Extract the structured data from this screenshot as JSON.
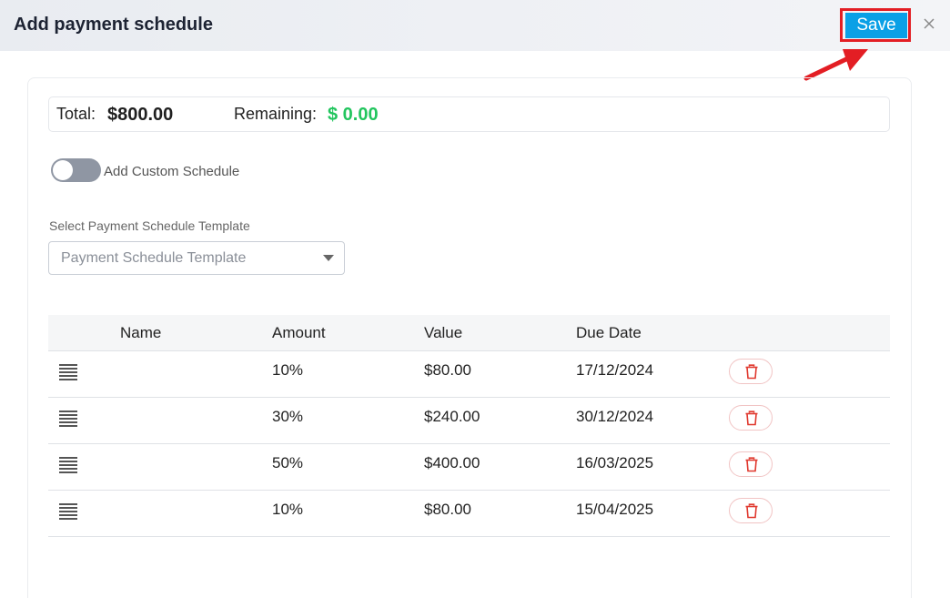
{
  "header": {
    "title": "Add payment schedule",
    "save_label": "Save"
  },
  "icons": {
    "close": "close-icon",
    "annotation": "red-arrow-icon",
    "drag": "drag-handle-icon",
    "delete": "trash-icon"
  },
  "colors": {
    "save_button": "#0aa0e6",
    "highlight": "#e31e24",
    "remaining_value": "#22c55e",
    "delete": "#e0392f"
  },
  "summary": {
    "total_label": "Total:",
    "total_value": "$800.00",
    "remaining_label": "Remaining:",
    "remaining_value": "$ 0.00"
  },
  "custom_schedule": {
    "label": "Add Custom Schedule",
    "enabled": false
  },
  "template_select": {
    "label": "Select Payment Schedule Template",
    "placeholder": "Payment Schedule Template"
  },
  "table": {
    "columns": [
      "Name",
      "Amount",
      "Value",
      "Due Date"
    ],
    "rows": [
      {
        "name": "",
        "amount": "10%",
        "value": "$80.00",
        "due_date": "17/12/2024"
      },
      {
        "name": "",
        "amount": "30%",
        "value": "$240.00",
        "due_date": "30/12/2024"
      },
      {
        "name": "",
        "amount": "50%",
        "value": "$400.00",
        "due_date": "16/03/2025"
      },
      {
        "name": "",
        "amount": "10%",
        "value": "$80.00",
        "due_date": "15/04/2025"
      }
    ]
  }
}
